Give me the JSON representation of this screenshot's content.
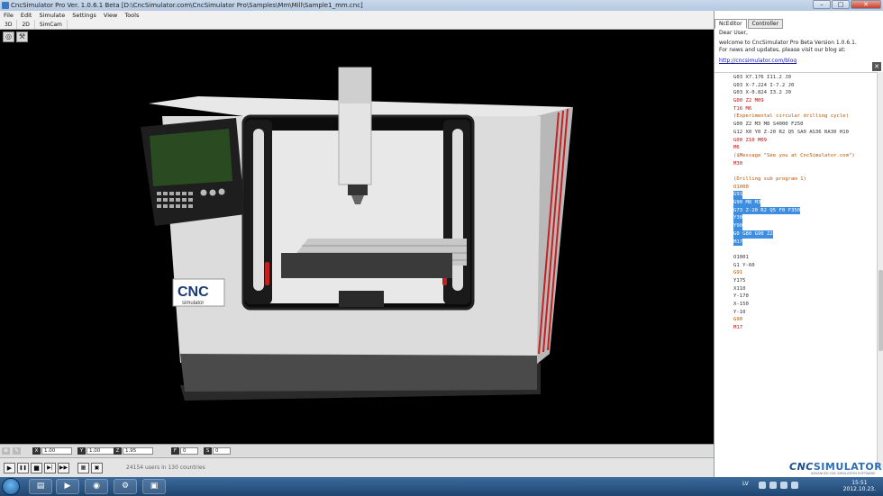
{
  "window": {
    "title": "CncSimulator Pro Ver. 1.0.6.1 Beta  [D:\\CncSimulator.com\\CncSimulator Pro\\Samples\\Mm\\Mill\\Sample1_mm.cnc]",
    "min_label": "–",
    "max_label": "□",
    "close_label": "✕"
  },
  "menu": [
    "File",
    "Edit",
    "Simulate",
    "Settings",
    "View",
    "Tools"
  ],
  "view_tabs": [
    "3D",
    "2D",
    "SimCam"
  ],
  "machine": {
    "logo_text": "CNC",
    "logo_sub": "simulator"
  },
  "coords": {
    "x_label": "X",
    "x_value": "1.00",
    "y_label": "Y",
    "y_value": "1.00",
    "z_label": "Z",
    "z_value": "1.95",
    "f_label": "F",
    "f_value": "0",
    "s_label": "S",
    "s_value": "0"
  },
  "playback": {
    "play": "▶",
    "pause": "❚❚",
    "stop": "■",
    "step": "▶|",
    "fast": "▶▶",
    "users_status": "24154 users in 130 countries"
  },
  "panel": {
    "tabs": [
      "NcEditor",
      "Controller"
    ],
    "greeting": "Dear User,",
    "welcome_line1": "welcome to CncSimulator Pro Beta Version 1.0.6.1.",
    "welcome_line2": "For news and updates, please visit our blog at:",
    "blog_link": "http://cncsimulator.com/blog",
    "close_label": "✕"
  },
  "code_lines": [
    {
      "text": "G03 X7.176 I11.2 J0",
      "kind": "g"
    },
    {
      "text": "G03 X-7.224 I-7.2 J0",
      "kind": "g"
    },
    {
      "text": "G03 X-0.824 I3.2 J0",
      "kind": "g"
    },
    {
      "text": "G00 Z2 M09",
      "kind": "m"
    },
    {
      "text": "T16 M6",
      "kind": "m"
    },
    {
      "text": "(Experimental circular drilling cycle)",
      "kind": "c"
    },
    {
      "text": "G00 Z2 M3 M8 S4000 F250",
      "kind": "g"
    },
    {
      "text": "G12 X0 Y0 Z-20 R2 Q5 SA0 AS36 RA30 H10",
      "kind": "g"
    },
    {
      "text": "G00 Z10 M09",
      "kind": "m"
    },
    {
      "text": "M6",
      "kind": "m"
    },
    {
      "text": "($Message \"See you at CncSimulator.com\")",
      "kind": "c"
    },
    {
      "text": "M30",
      "kind": "m"
    },
    {
      "text": "",
      "kind": "g"
    },
    {
      "text": "(Drilling sub program 1)",
      "kind": "c"
    },
    {
      "text": "O1000",
      "kind": "c"
    },
    {
      "text": "G91",
      "kind": "sel"
    },
    {
      "text": "G90 M8 M3",
      "kind": "sel"
    },
    {
      "text": "G73 Z-20 R2 Q5 F0 F350",
      "kind": "sel"
    },
    {
      "text": "Y30",
      "kind": "sel"
    },
    {
      "text": "Y90",
      "kind": "sel"
    },
    {
      "text": "G0 G80 G90 Z2",
      "kind": "sel"
    },
    {
      "text": "M17",
      "kind": "sel"
    },
    {
      "text": "",
      "kind": "g"
    },
    {
      "text": "O1001",
      "kind": "g"
    },
    {
      "text": "G1 Y-60",
      "kind": "g"
    },
    {
      "text": "G91",
      "kind": "c"
    },
    {
      "text": "Y175",
      "kind": "g"
    },
    {
      "text": "X110",
      "kind": "g"
    },
    {
      "text": "Y-170",
      "kind": "g"
    },
    {
      "text": "X-150",
      "kind": "g"
    },
    {
      "text": "Y-10",
      "kind": "g"
    },
    {
      "text": "G90",
      "kind": "c"
    },
    {
      "text": "M17",
      "kind": "m"
    }
  ],
  "brand": {
    "logo_cnc": "CNC",
    "logo_rest": "SIMULATOR",
    "tagline": "ADVANCED CNC SIMULATION SOFTWARE"
  },
  "taskbar": {
    "lang": "LV",
    "time": "15:51",
    "date": "2012.10.23."
  }
}
